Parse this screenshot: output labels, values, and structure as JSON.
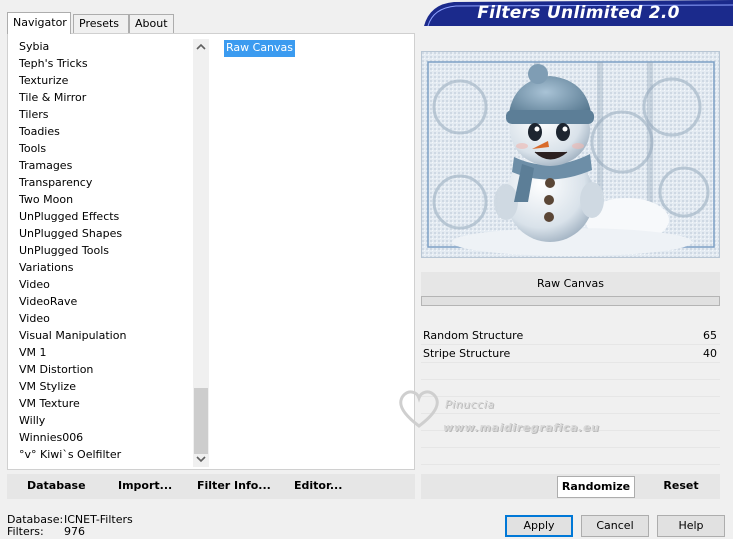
{
  "tabs": [
    {
      "label": "Navigator",
      "active": true
    },
    {
      "label": "Presets",
      "active": false
    },
    {
      "label": "About",
      "active": false
    }
  ],
  "banner": {
    "title": "Filters Unlimited 2.0"
  },
  "categories": [
    "Sybia",
    "Teph's Tricks",
    "Texturize",
    "Tile & Mirror",
    "Tilers",
    "Toadies",
    "Tools",
    "Tramages",
    "Transparency",
    "Two Moon",
    "UnPlugged Effects",
    "UnPlugged Shapes",
    "UnPlugged Tools",
    "Variations",
    "Video",
    "VideoRave",
    "Video",
    "Visual Manipulation",
    "VM 1",
    "VM Distortion",
    "VM Stylize",
    "VM Texture",
    "Willy",
    "Winnies006",
    "°v° Kiwi`s Oelfilter"
  ],
  "filters": [
    {
      "label": "Raw Canvas",
      "selected": true
    }
  ],
  "filter_name": "Raw Canvas",
  "parameters": [
    {
      "name": "Random Structure",
      "value": "65"
    },
    {
      "name": "Stripe Structure",
      "value": "40"
    }
  ],
  "watermark": {
    "name": "Pinuccia",
    "url": "www.maidiregrafica.eu"
  },
  "left_buttons": {
    "database": "Database",
    "import": "Import...",
    "filter_info": "Filter Info...",
    "editor": "Editor..."
  },
  "right_buttons": {
    "randomize": "Randomize",
    "reset": "Reset"
  },
  "dialog_buttons": {
    "apply": "Apply",
    "cancel": "Cancel",
    "help": "Help"
  },
  "status": {
    "database_label": "Database:",
    "database_value": "ICNET-Filters",
    "filters_label": "Filters:",
    "filters_value": "976"
  },
  "colors": {
    "banner_blue": "#1b2a8c",
    "selection_blue": "#3b9bf0",
    "default_button_border": "#0078d7"
  },
  "icons": {
    "scroll_up": "chevron-up-icon",
    "scroll_down": "chevron-down-icon",
    "watermark_heart": "heart-icon"
  }
}
